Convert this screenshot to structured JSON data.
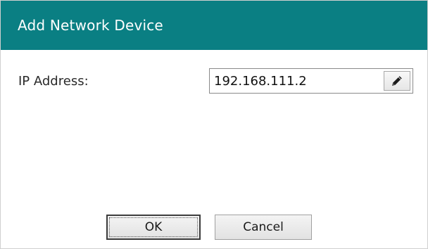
{
  "dialog": {
    "title": "Add Network Device",
    "ip_label": "IP Address:",
    "ip_value": "192.168.111.2",
    "edit_icon": "pencil-icon",
    "ok_label": "OK",
    "cancel_label": "Cancel"
  },
  "colors": {
    "titlebar": "#0a7f83",
    "title_text": "#ffffff",
    "background": "#ffffff"
  }
}
